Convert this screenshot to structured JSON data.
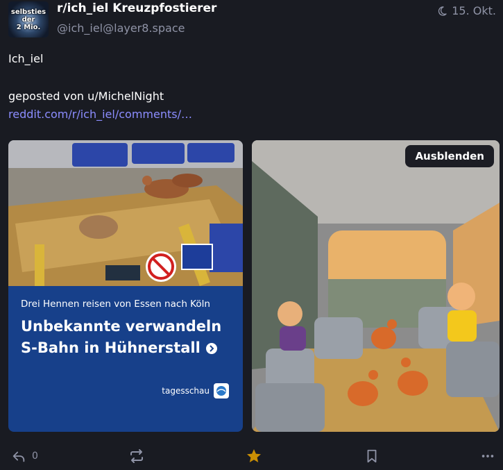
{
  "author": {
    "avatar_lines": [
      "selbsties",
      "der",
      "2 Mio."
    ],
    "display_name": "r/ich_iel Kreuzpfostierer",
    "handle": "@ich_iel@layer8.space"
  },
  "timestamp": "15. Okt.",
  "post": {
    "line1": "Ich_iel",
    "line2": "geposted von u/MichelNight",
    "link": "reddit.com/r/ich_iel/comments/…"
  },
  "media": {
    "left": {
      "subtitle": "Drei Hennen reisen von Essen nach Köln",
      "headline_line1": "Unbekannte verwandeln",
      "headline_line2": "S-Bahn in Hühnerstall",
      "brand": "tagesschau"
    },
    "hide_button": "Ausblenden"
  },
  "actions": {
    "reply_count": "0",
    "star_color": "#ca8f04"
  }
}
